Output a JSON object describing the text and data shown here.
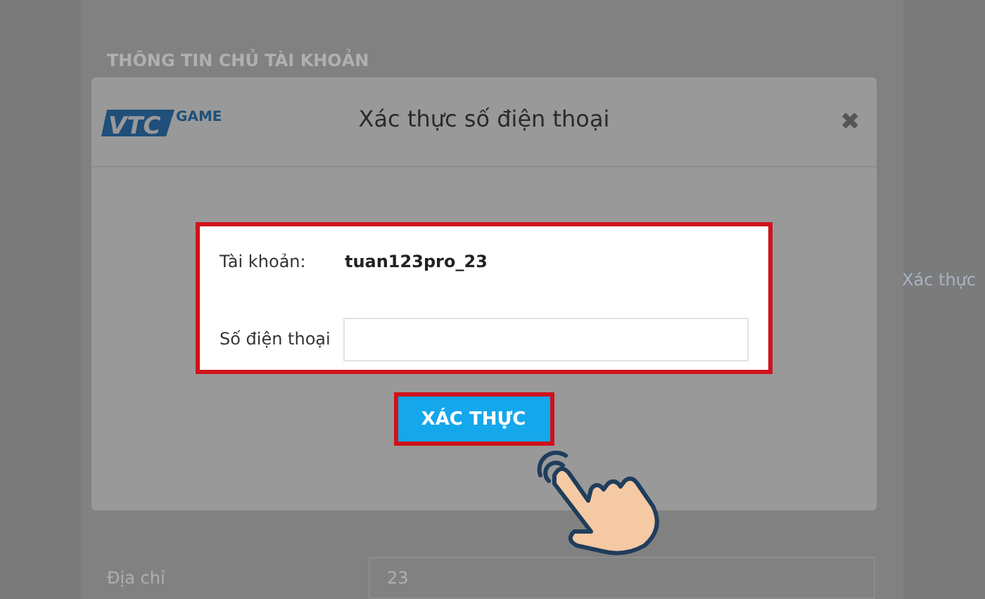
{
  "page": {
    "section_title": "THÔNG TIN CHỦ TÀI KHOẢN",
    "side_link": "Xác thực",
    "address": {
      "label": "Địa chỉ",
      "value": "23"
    }
  },
  "dialog": {
    "logo": {
      "mark": "VTC",
      "name": "GAME"
    },
    "title": "Xác thực số điện thoại",
    "close": "✖",
    "account": {
      "label": "Tài khoản:",
      "value": "tuan123pro_23"
    },
    "phone": {
      "label": "Số điện thoại"
    },
    "button": "XÁC THỰC"
  }
}
